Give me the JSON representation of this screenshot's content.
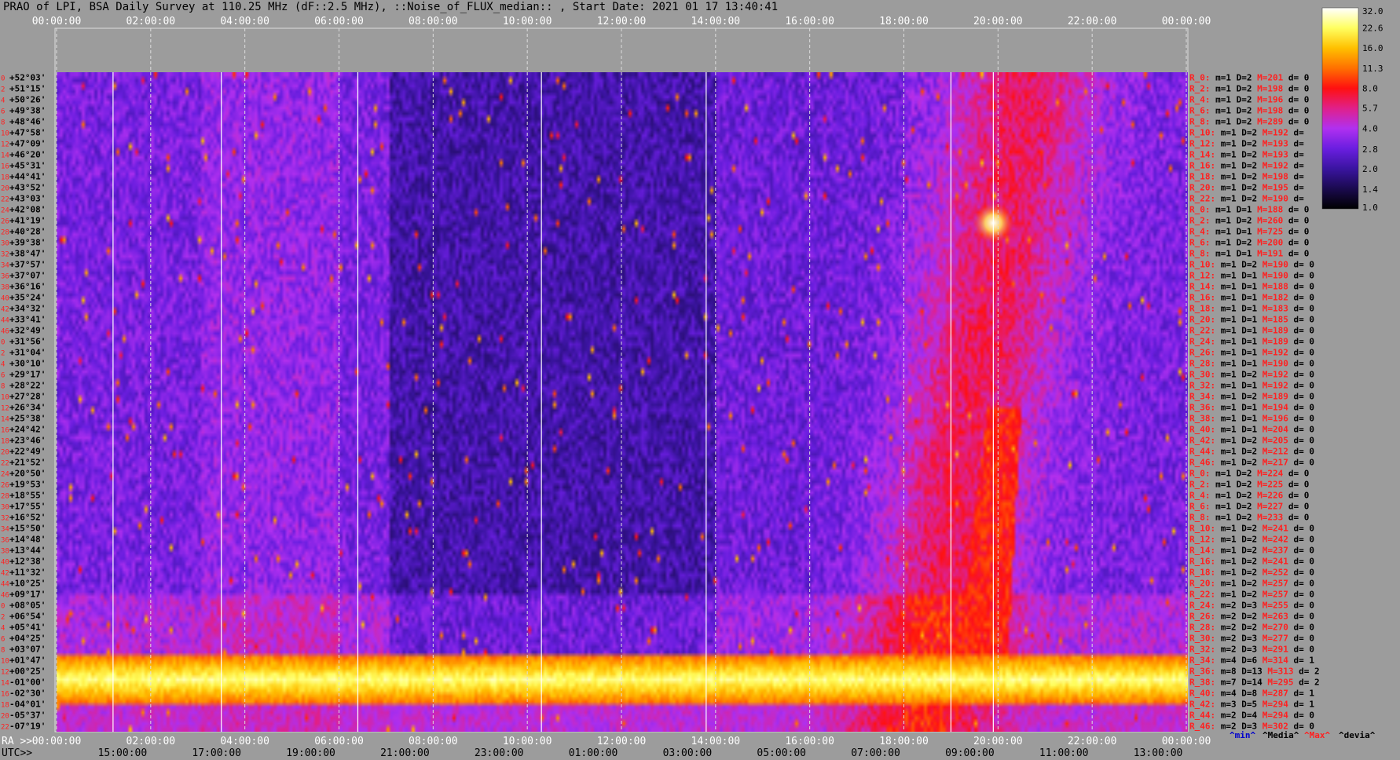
{
  "chart_data": {
    "type": "heatmap",
    "title": "PRAO of LPI, BSA Daily Survey at 110.25 MHz (dF::2.5 MHz), ::Noise_of_FLUX_median:: , Start Date: 2021 01 17 13:40:41",
    "top_time_ticks": [
      "00:00:00",
      "02:00:00",
      "04:00:00",
      "06:00:00",
      "08:00:00",
      "10:00:00",
      "12:00:00",
      "14:00:00",
      "16:00:00",
      "18:00:00",
      "20:00:00",
      "22:00:00",
      "00:00:00"
    ],
    "ra_axis_label": "RA >>",
    "ra_ticks": [
      "00:00:00",
      "02:00:00",
      "04:00:00",
      "06:00:00",
      "08:00:00",
      "10:00:00",
      "12:00:00",
      "14:00:00",
      "16:00:00",
      "18:00:00",
      "20:00:00",
      "22:00:00",
      "00:00:00"
    ],
    "utc_axis_label": "UTC>>",
    "utc_ticks": [
      "15:00:00",
      "17:00:00",
      "19:00:00",
      "21:00:00",
      "23:00:00",
      "01:00:00",
      "03:00:00",
      "05:00:00",
      "07:00:00",
      "09:00:00",
      "11:00:00",
      "13:00:00"
    ],
    "dec_labels": [
      "+52°03'",
      "+51°15'",
      "+50°26'",
      "+49°38'",
      "+48°46'",
      "+47°58'",
      "+47°09'",
      "+46°20'",
      "+45°31'",
      "+44°41'",
      "+43°52'",
      "+43°03'",
      "+42°08'",
      "+41°19'",
      "+40°28'",
      "+39°38'",
      "+38°47'",
      "+37°57'",
      "+37°07'",
      "+36°16'",
      "+35°24'",
      "+34°32'",
      "+33°41'",
      "+32°49'",
      "+31°56'",
      "+31°04'",
      "+30°10'",
      "+29°17'",
      "+28°22'",
      "+27°28'",
      "+26°34'",
      "+25°38'",
      "+24°42'",
      "+23°46'",
      "+22°49'",
      "+21°52'",
      "+20°50'",
      "+19°53'",
      "+18°55'",
      "+17°55'",
      "+16°52'",
      "+15°50'",
      "+14°48'",
      "+13°44'",
      "+12°38'",
      "+11°32'",
      "+10°25'",
      "+09°17'",
      "+08°05'",
      "+06°54'",
      "+05°41'",
      "+04°25'",
      "+03°07'",
      "+01°47'",
      "+00°25'",
      "-01°00'",
      "-02°30'",
      "-04°01'",
      "-05°37'",
      "-07°19'"
    ],
    "row_numbers": [
      "0",
      "2",
      "4",
      "6",
      "8",
      "10",
      "12",
      "14",
      "16",
      "18",
      "20",
      "22",
      "24",
      "26",
      "28",
      "30",
      "32",
      "34",
      "36",
      "38",
      "40",
      "42",
      "44",
      "46",
      "0",
      "2",
      "4",
      "6",
      "8",
      "10",
      "12",
      "14",
      "16",
      "18",
      "20",
      "22",
      "24",
      "26",
      "28",
      "30",
      "32",
      "34",
      "36",
      "38",
      "40",
      "42",
      "44",
      "46",
      "0",
      "2",
      "4",
      "6",
      "8",
      "10",
      "12",
      "14",
      "16",
      "18",
      "20",
      "22"
    ],
    "stats_rows": [
      {
        "r": "R_0:",
        "m": "m=1",
        "D": "D=2",
        "M": "M=201",
        "d": "d= 0"
      },
      {
        "r": "R_2:",
        "m": "m=1",
        "D": "D=2",
        "M": "M=198",
        "d": "d= 0"
      },
      {
        "r": "R_4:",
        "m": "m=1",
        "D": "D=2",
        "M": "M=196",
        "d": "d= 0"
      },
      {
        "r": "R_6:",
        "m": "m=1",
        "D": "D=2",
        "M": "M=198",
        "d": "d= 0"
      },
      {
        "r": "R_8:",
        "m": "m=1",
        "D": "D=2",
        "M": "M=289",
        "d": "d= 0"
      },
      {
        "r": "R_10:",
        "m": "m=1",
        "D": "D=2",
        "M": "M=192",
        "d": "d="
      },
      {
        "r": "R_12:",
        "m": "m=1",
        "D": "D=2",
        "M": "M=193",
        "d": "d="
      },
      {
        "r": "R_14:",
        "m": "m=1",
        "D": "D=2",
        "M": "M=193",
        "d": "d="
      },
      {
        "r": "R_16:",
        "m": "m=1",
        "D": "D=2",
        "M": "M=192",
        "d": "d="
      },
      {
        "r": "R_18:",
        "m": "m=1",
        "D": "D=2",
        "M": "M=198",
        "d": "d="
      },
      {
        "r": "R_20:",
        "m": "m=1",
        "D": "D=2",
        "M": "M=195",
        "d": "d="
      },
      {
        "r": "R_22:",
        "m": "m=1",
        "D": "D=2",
        "M": "M=190",
        "d": "d="
      },
      {
        "r": "R_0:",
        "m": "m=1",
        "D": "D=1",
        "M": "M=188",
        "d": "d= 0"
      },
      {
        "r": "R_2:",
        "m": "m=1",
        "D": "D=2",
        "M": "M=260",
        "d": "d= 0"
      },
      {
        "r": "R_4:",
        "m": "m=1",
        "D": "D=1",
        "M": "M=725",
        "d": "d= 0"
      },
      {
        "r": "R_6:",
        "m": "m=1",
        "D": "D=2",
        "M": "M=200",
        "d": "d= 0"
      },
      {
        "r": "R_8:",
        "m": "m=1",
        "D": "D=1",
        "M": "M=191",
        "d": "d= 0"
      },
      {
        "r": "R_10:",
        "m": "m=1",
        "D": "D=2",
        "M": "M=190",
        "d": "d= 0"
      },
      {
        "r": "R_12:",
        "m": "m=1",
        "D": "D=1",
        "M": "M=190",
        "d": "d= 0"
      },
      {
        "r": "R_14:",
        "m": "m=1",
        "D": "D=1",
        "M": "M=188",
        "d": "d= 0"
      },
      {
        "r": "R_16:",
        "m": "m=1",
        "D": "D=1",
        "M": "M=182",
        "d": "d= 0"
      },
      {
        "r": "R_18:",
        "m": "m=1",
        "D": "D=1",
        "M": "M=183",
        "d": "d= 0"
      },
      {
        "r": "R_20:",
        "m": "m=1",
        "D": "D=1",
        "M": "M=185",
        "d": "d= 0"
      },
      {
        "r": "R_22:",
        "m": "m=1",
        "D": "D=1",
        "M": "M=189",
        "d": "d= 0"
      },
      {
        "r": "R_24:",
        "m": "m=1",
        "D": "D=1",
        "M": "M=189",
        "d": "d= 0"
      },
      {
        "r": "R_26:",
        "m": "m=1",
        "D": "D=1",
        "M": "M=192",
        "d": "d= 0"
      },
      {
        "r": "R_28:",
        "m": "m=1",
        "D": "D=1",
        "M": "M=190",
        "d": "d= 0"
      },
      {
        "r": "R_30:",
        "m": "m=1",
        "D": "D=2",
        "M": "M=192",
        "d": "d= 0"
      },
      {
        "r": "R_32:",
        "m": "m=1",
        "D": "D=1",
        "M": "M=192",
        "d": "d= 0"
      },
      {
        "r": "R_34:",
        "m": "m=1",
        "D": "D=2",
        "M": "M=189",
        "d": "d= 0"
      },
      {
        "r": "R_36:",
        "m": "m=1",
        "D": "D=1",
        "M": "M=194",
        "d": "d= 0"
      },
      {
        "r": "R_38:",
        "m": "m=1",
        "D": "D=1",
        "M": "M=196",
        "d": "d= 0"
      },
      {
        "r": "R_40:",
        "m": "m=1",
        "D": "D=1",
        "M": "M=204",
        "d": "d= 0"
      },
      {
        "r": "R_42:",
        "m": "m=1",
        "D": "D=2",
        "M": "M=205",
        "d": "d= 0"
      },
      {
        "r": "R_44:",
        "m": "m=1",
        "D": "D=2",
        "M": "M=212",
        "d": "d= 0"
      },
      {
        "r": "R_46:",
        "m": "m=1",
        "D": "D=2",
        "M": "M=217",
        "d": "d= 0"
      },
      {
        "r": "R_0:",
        "m": "m=1",
        "D": "D=2",
        "M": "M=224",
        "d": "d= 0"
      },
      {
        "r": "R_2:",
        "m": "m=1",
        "D": "D=2",
        "M": "M=225",
        "d": "d= 0"
      },
      {
        "r": "R_4:",
        "m": "m=1",
        "D": "D=2",
        "M": "M=226",
        "d": "d= 0"
      },
      {
        "r": "R_6:",
        "m": "m=1",
        "D": "D=2",
        "M": "M=227",
        "d": "d= 0"
      },
      {
        "r": "R_8:",
        "m": "m=1",
        "D": "D=2",
        "M": "M=233",
        "d": "d= 0"
      },
      {
        "r": "R_10:",
        "m": "m=1",
        "D": "D=2",
        "M": "M=241",
        "d": "d= 0"
      },
      {
        "r": "R_12:",
        "m": "m=1",
        "D": "D=2",
        "M": "M=242",
        "d": "d= 0"
      },
      {
        "r": "R_14:",
        "m": "m=1",
        "D": "D=2",
        "M": "M=237",
        "d": "d= 0"
      },
      {
        "r": "R_16:",
        "m": "m=1",
        "D": "D=2",
        "M": "M=241",
        "d": "d= 0"
      },
      {
        "r": "R_18:",
        "m": "m=1",
        "D": "D=2",
        "M": "M=252",
        "d": "d= 0"
      },
      {
        "r": "R_20:",
        "m": "m=1",
        "D": "D=2",
        "M": "M=257",
        "d": "d= 0"
      },
      {
        "r": "R_22:",
        "m": "m=1",
        "D": "D=2",
        "M": "M=257",
        "d": "d= 0"
      },
      {
        "r": "R_24:",
        "m": "m=2",
        "D": "D=3",
        "M": "M=255",
        "d": "d= 0"
      },
      {
        "r": "R_26:",
        "m": "m=2",
        "D": "D=2",
        "M": "M=263",
        "d": "d= 0"
      },
      {
        "r": "R_28:",
        "m": "m=2",
        "D": "D=2",
        "M": "M=270",
        "d": "d= 0"
      },
      {
        "r": "R_30:",
        "m": "m=2",
        "D": "D=3",
        "M": "M=277",
        "d": "d= 0"
      },
      {
        "r": "R_32:",
        "m": "m=2",
        "D": "D=3",
        "M": "M=291",
        "d": "d= 0"
      },
      {
        "r": "R_34:",
        "m": "m=4",
        "D": "D=6",
        "M": "M=314",
        "d": "d= 1"
      },
      {
        "r": "R_36:",
        "m": "m=8",
        "D": "D=13",
        "M": "M=313",
        "d": "d= 2"
      },
      {
        "r": "R_38:",
        "m": "m=7",
        "D": "D=14",
        "M": "M=295",
        "d": "d= 2"
      },
      {
        "r": "R_40:",
        "m": "m=4",
        "D": "D=8",
        "M": "M=287",
        "d": "d= 1"
      },
      {
        "r": "R_42:",
        "m": "m=3",
        "D": "D=5",
        "M": "M=294",
        "d": "d= 1"
      },
      {
        "r": "R_44:",
        "m": "m=2",
        "D": "D=4",
        "M": "M=294",
        "d": "d= 0"
      },
      {
        "r": "R_46:",
        "m": "m=2",
        "D": "D=3",
        "M": "M=302",
        "d": "d= 0"
      }
    ],
    "stats_footer": [
      "^min^",
      "^Media^",
      "^Max^",
      "^devia^"
    ],
    "colorbar_ticks": [
      "32.0",
      "22.6",
      "16.0",
      "11.3",
      "8.0",
      "5.7",
      "4.0",
      "2.8",
      "2.0",
      "1.4",
      "1.0"
    ],
    "colorbar_range": [
      1.0,
      32.0
    ],
    "colorbar_scale": "log",
    "colormap_stops": [
      "#000000",
      "#1a0a4e",
      "#3a14a0",
      "#6a1ee0",
      "#b030f0",
      "#e0208a",
      "#ff1010",
      "#ff7000",
      "#ffc000",
      "#ffff60",
      "#ffffff"
    ],
    "grid": true,
    "bright_band_dec_range": [
      "+01°47'",
      "-02°30'"
    ],
    "solid_vertical_lines_hours": [
      1.2,
      3.5,
      6.4,
      10.3,
      13.8,
      19.0,
      19.9
    ]
  }
}
